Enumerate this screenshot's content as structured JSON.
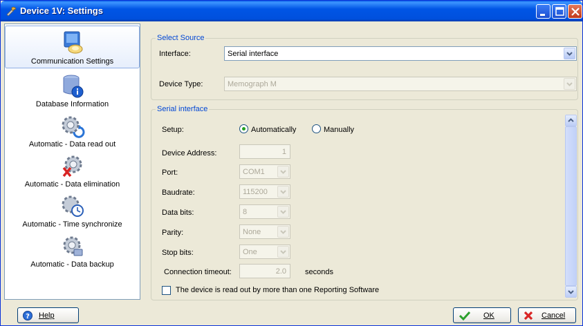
{
  "window": {
    "title": "Device 1V: Settings"
  },
  "sidebar": {
    "items": [
      {
        "label": "Communication Settings",
        "icon": "communication-icon",
        "selected": true
      },
      {
        "label": "Database Information",
        "icon": "database-info-icon"
      },
      {
        "label": "Automatic - Data read out",
        "icon": "gear-refresh-icon"
      },
      {
        "label": "Automatic - Data elimination",
        "icon": "gear-delete-icon"
      },
      {
        "label": "Automatic - Time synchronize",
        "icon": "gear-clock-icon"
      },
      {
        "label": "Automatic - Data backup",
        "icon": "gear-backup-icon"
      }
    ]
  },
  "select_source": {
    "title": "Select Source",
    "interface_label": "Interface:",
    "interface_value": "Serial interface",
    "device_type_label": "Device Type:",
    "device_type_value": "Memograph M"
  },
  "serial": {
    "title": "Serial interface",
    "setup_label": "Setup:",
    "setup_auto": "Automatically",
    "setup_manual": "Manually",
    "setup_selected": "Automatically",
    "device_address_label": "Device Address:",
    "device_address_value": "1",
    "port_label": "Port:",
    "port_value": "COM1",
    "baudrate_label": "Baudrate:",
    "baudrate_value": "115200",
    "data_bits_label": "Data bits:",
    "data_bits_value": "8",
    "parity_label": "Parity:",
    "parity_value": "None",
    "stop_bits_label": "Stop bits:",
    "stop_bits_value": "One",
    "timeout_label": "Connection timeout:",
    "timeout_value": "2.0",
    "timeout_unit": "seconds",
    "multi_read_label": "The device is read out by more than one Reporting Software",
    "multi_read_checked": false
  },
  "buttons": {
    "help": "Help",
    "ok": "OK",
    "cancel": "Cancel"
  },
  "colors": {
    "accent": "#0046d5",
    "titlebar": "#0055e5",
    "face": "#ece9d8"
  }
}
